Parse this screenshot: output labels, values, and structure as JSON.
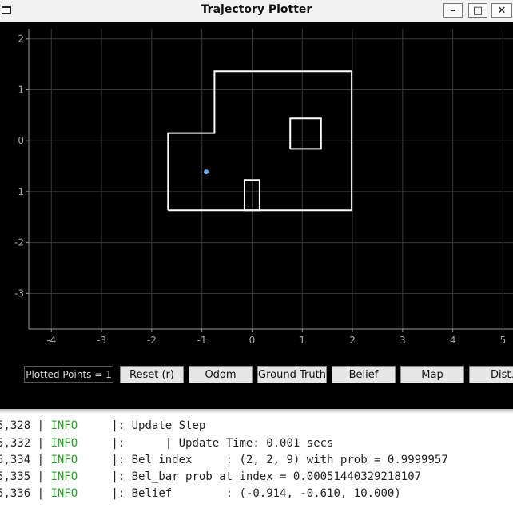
{
  "window": {
    "title": "Trajectory Plotter",
    "buttons": {
      "minimize": "–",
      "maximize": "□",
      "close": "✕"
    }
  },
  "chart_data": {
    "type": "scatter",
    "title": "",
    "xlabel": "",
    "ylabel": "",
    "xlim": [
      -4.45,
      5.2
    ],
    "ylim": [
      -3.7,
      2.2
    ],
    "x_ticks": [
      -4,
      -3,
      -2,
      -1,
      0,
      1,
      2,
      3,
      4,
      5
    ],
    "y_ticks": [
      -3,
      -2,
      -1,
      0,
      1,
      2
    ],
    "grid": true,
    "points": [
      {
        "x": -0.914,
        "y": -0.61,
        "color": "#6aa8f0"
      }
    ],
    "map_lines": [
      {
        "points": [
          [
            -1.675,
            -1.365
          ],
          [
            1.985,
            -1.365
          ],
          [
            1.985,
            1.365
          ],
          [
            -0.75,
            1.365
          ],
          [
            -0.75,
            0.15
          ],
          [
            -1.675,
            0.15
          ],
          [
            -1.675,
            -1.365
          ]
        ]
      },
      {
        "points": [
          [
            0.76,
            -0.16
          ],
          [
            1.375,
            -0.16
          ],
          [
            1.375,
            0.44
          ],
          [
            0.76,
            0.44
          ],
          [
            0.76,
            -0.16
          ]
        ]
      },
      {
        "points": [
          [
            -0.15,
            -1.365
          ],
          [
            0.15,
            -1.365
          ],
          [
            0.15,
            -0.77
          ],
          [
            -0.15,
            -0.77
          ],
          [
            -0.15,
            -1.365
          ]
        ]
      }
    ],
    "colors": {
      "background": "#000000",
      "grid": "#3a3a3a",
      "axis": "#9a9a9a",
      "map": "#ffffff",
      "point": "#6aa8f0",
      "tick_label": "#a8a8a8"
    }
  },
  "controls": {
    "plotted_points": "Plotted Points = 1",
    "buttons": [
      "Reset (r)",
      "Odom",
      "Ground Truth",
      "Belief",
      "Map",
      "Dist."
    ]
  },
  "terminal": {
    "lines": [
      {
        "time": "5,328",
        "level": "INFO",
        "message": "|: Update Step"
      },
      {
        "time": "5,332",
        "level": "INFO",
        "message": "|:      | Update Time: 0.001 secs"
      },
      {
        "time": "5,334",
        "level": "INFO",
        "message": "|: Bel index     : (2, 2, 9) with prob = 0.9999957"
      },
      {
        "time": "5,335",
        "level": "INFO",
        "message": "|: Bel_bar prob at index = 0.00051440329218107"
      },
      {
        "time": "5,336",
        "level": "INFO",
        "message": "|: Belief        : (-0.914, -0.610, 10.000)"
      }
    ],
    "level_color": "#2aa02a"
  }
}
